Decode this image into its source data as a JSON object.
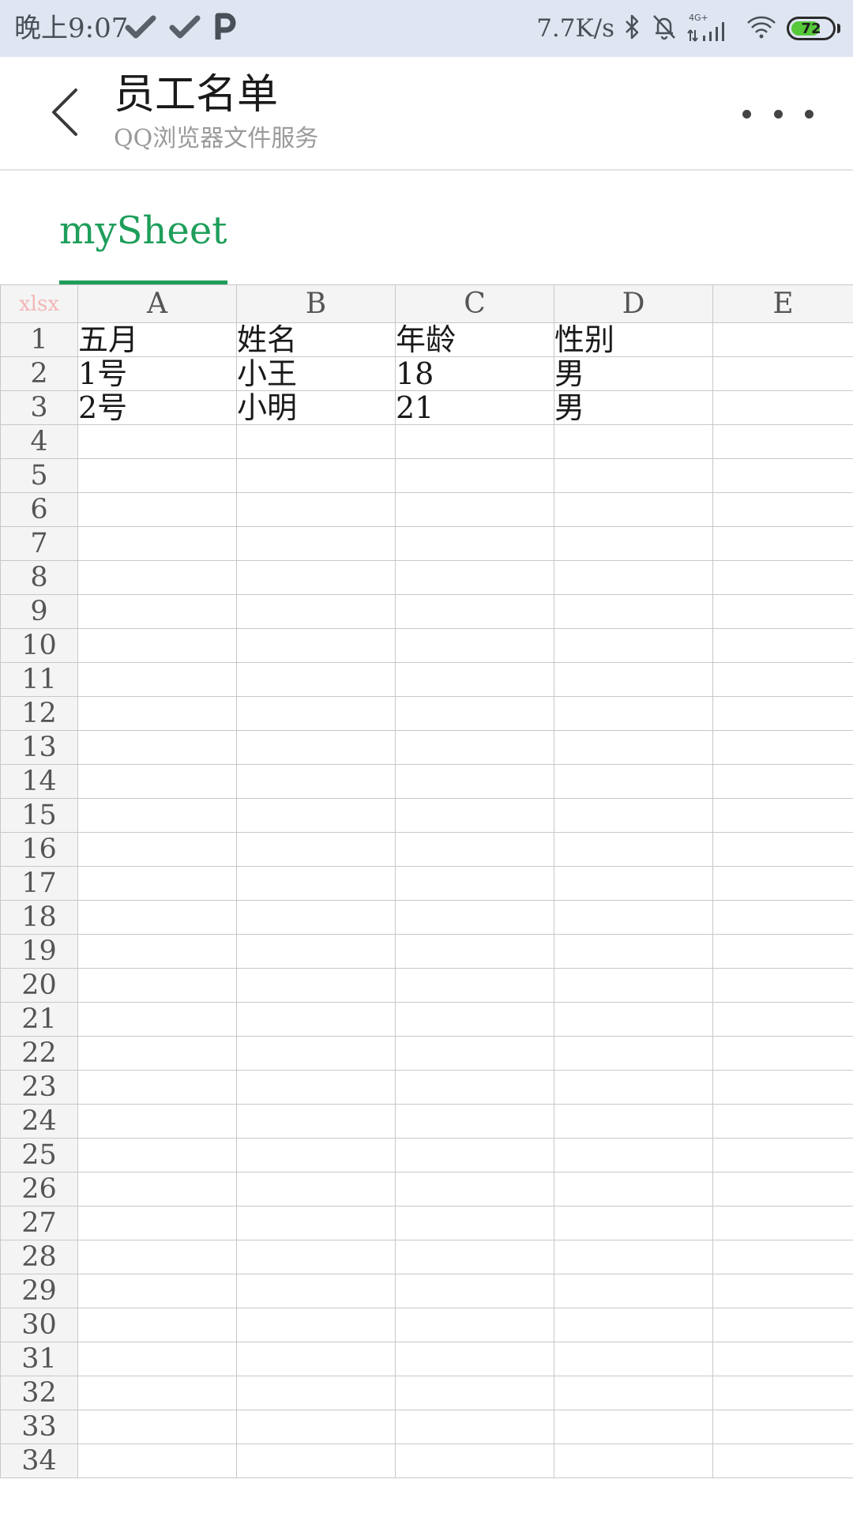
{
  "status_bar": {
    "time": "晚上9:07",
    "left_icons": [
      "check-icon",
      "check-icon",
      "p-icon"
    ],
    "net_speed": "7.7K/s",
    "network_type": "4G+",
    "battery_level": "72",
    "battery_fraction": 0.72,
    "battery_color": "#56c93a"
  },
  "title_bar": {
    "title": "员工名单",
    "subtitle": "QQ浏览器文件服务"
  },
  "sheet_tabs": [
    {
      "label": "mySheet",
      "active": true,
      "color": "#1e9e5a"
    }
  ],
  "grid": {
    "corner_label": "xlsx",
    "columns": [
      "A",
      "B",
      "C",
      "D",
      "E"
    ],
    "rows": [
      {
        "num": "1",
        "cells": [
          "五月",
          "姓名",
          "年龄",
          "性别",
          ""
        ]
      },
      {
        "num": "2",
        "cells": [
          "1号",
          "小王",
          "18",
          "男",
          ""
        ]
      },
      {
        "num": "3",
        "cells": [
          "2号",
          "小明",
          "21",
          "男",
          ""
        ]
      },
      {
        "num": "4",
        "cells": [
          "",
          "",
          "",
          "",
          ""
        ]
      },
      {
        "num": "5",
        "cells": [
          "",
          "",
          "",
          "",
          ""
        ]
      },
      {
        "num": "6",
        "cells": [
          "",
          "",
          "",
          "",
          ""
        ]
      },
      {
        "num": "7",
        "cells": [
          "",
          "",
          "",
          "",
          ""
        ]
      },
      {
        "num": "8",
        "cells": [
          "",
          "",
          "",
          "",
          ""
        ]
      },
      {
        "num": "9",
        "cells": [
          "",
          "",
          "",
          "",
          ""
        ]
      },
      {
        "num": "10",
        "cells": [
          "",
          "",
          "",
          "",
          ""
        ]
      },
      {
        "num": "11",
        "cells": [
          "",
          "",
          "",
          "",
          ""
        ]
      },
      {
        "num": "12",
        "cells": [
          "",
          "",
          "",
          "",
          ""
        ]
      },
      {
        "num": "13",
        "cells": [
          "",
          "",
          "",
          "",
          ""
        ]
      },
      {
        "num": "14",
        "cells": [
          "",
          "",
          "",
          "",
          ""
        ]
      },
      {
        "num": "15",
        "cells": [
          "",
          "",
          "",
          "",
          ""
        ]
      },
      {
        "num": "16",
        "cells": [
          "",
          "",
          "",
          "",
          ""
        ]
      },
      {
        "num": "17",
        "cells": [
          "",
          "",
          "",
          "",
          ""
        ]
      },
      {
        "num": "18",
        "cells": [
          "",
          "",
          "",
          "",
          ""
        ]
      },
      {
        "num": "19",
        "cells": [
          "",
          "",
          "",
          "",
          ""
        ]
      },
      {
        "num": "20",
        "cells": [
          "",
          "",
          "",
          "",
          ""
        ]
      },
      {
        "num": "21",
        "cells": [
          "",
          "",
          "",
          "",
          ""
        ]
      },
      {
        "num": "22",
        "cells": [
          "",
          "",
          "",
          "",
          ""
        ]
      },
      {
        "num": "23",
        "cells": [
          "",
          "",
          "",
          "",
          ""
        ]
      },
      {
        "num": "24",
        "cells": [
          "",
          "",
          "",
          "",
          ""
        ]
      },
      {
        "num": "25",
        "cells": [
          "",
          "",
          "",
          "",
          ""
        ]
      },
      {
        "num": "26",
        "cells": [
          "",
          "",
          "",
          "",
          ""
        ]
      },
      {
        "num": "27",
        "cells": [
          "",
          "",
          "",
          "",
          ""
        ]
      },
      {
        "num": "28",
        "cells": [
          "",
          "",
          "",
          "",
          ""
        ]
      },
      {
        "num": "29",
        "cells": [
          "",
          "",
          "",
          "",
          ""
        ]
      },
      {
        "num": "30",
        "cells": [
          "",
          "",
          "",
          "",
          ""
        ]
      },
      {
        "num": "31",
        "cells": [
          "",
          "",
          "",
          "",
          ""
        ]
      },
      {
        "num": "32",
        "cells": [
          "",
          "",
          "",
          "",
          ""
        ]
      },
      {
        "num": "33",
        "cells": [
          "",
          "",
          "",
          "",
          ""
        ]
      },
      {
        "num": "34",
        "cells": [
          "",
          "",
          "",
          "",
          ""
        ]
      }
    ]
  }
}
